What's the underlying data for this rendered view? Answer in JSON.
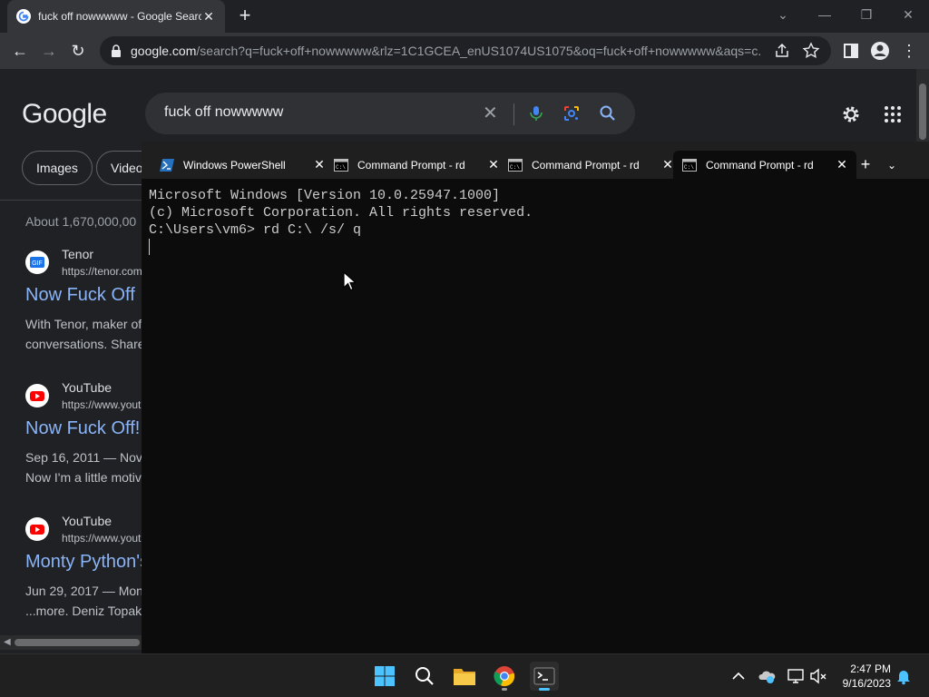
{
  "browser": {
    "tab_title": "fuck off nowwwww - Google Search",
    "url_host": "google.com",
    "url_path": "/search?q=fuck+off+nowwwww&rlz=1C1GCEA_enUS1074US1075&oq=fuck+off+nowwwww&aqs=c..."
  },
  "google": {
    "logo": "Google",
    "query": "fuck off nowwwww",
    "chips": [
      "Images",
      "Videos"
    ],
    "about": "About 1,670,000,00",
    "results": [
      {
        "site": "Tenor",
        "url": "https://tenor.com",
        "title": "Now Fuck Off",
        "snippet": [
          "With Tenor, maker of",
          "conversations. Share"
        ]
      },
      {
        "site": "YouTube",
        "url": "https://www.yout",
        "title": "Now Fuck Off!",
        "snippet": [
          "Sep 16, 2011 — Nov",
          "Now I'm a little motiv"
        ]
      },
      {
        "site": "YouTube",
        "url": "https://www.yout",
        "title": "Monty Python's",
        "snippet": [
          "Jun 29, 2017 — Mon",
          "...more. Deniz Topak"
        ]
      }
    ]
  },
  "terminal": {
    "tabs": [
      {
        "label": "Windows PowerShell"
      },
      {
        "label": "Command Prompt - rd"
      },
      {
        "label": "Command Prompt - rd"
      },
      {
        "label": "Command Prompt - rd"
      }
    ],
    "lines": [
      "Microsoft Windows [Version 10.0.25947.1000]",
      "(c) Microsoft Corporation. All rights reserved.",
      "",
      "C:\\Users\\vm6> rd C:\\ /s/ q"
    ]
  },
  "taskbar": {
    "time": "2:47 PM",
    "date": "9/16/2023"
  },
  "colors": {
    "accent": "#4cc2ff",
    "link": "#8ab4f8",
    "terminal_bg": "#0c0c0c"
  }
}
